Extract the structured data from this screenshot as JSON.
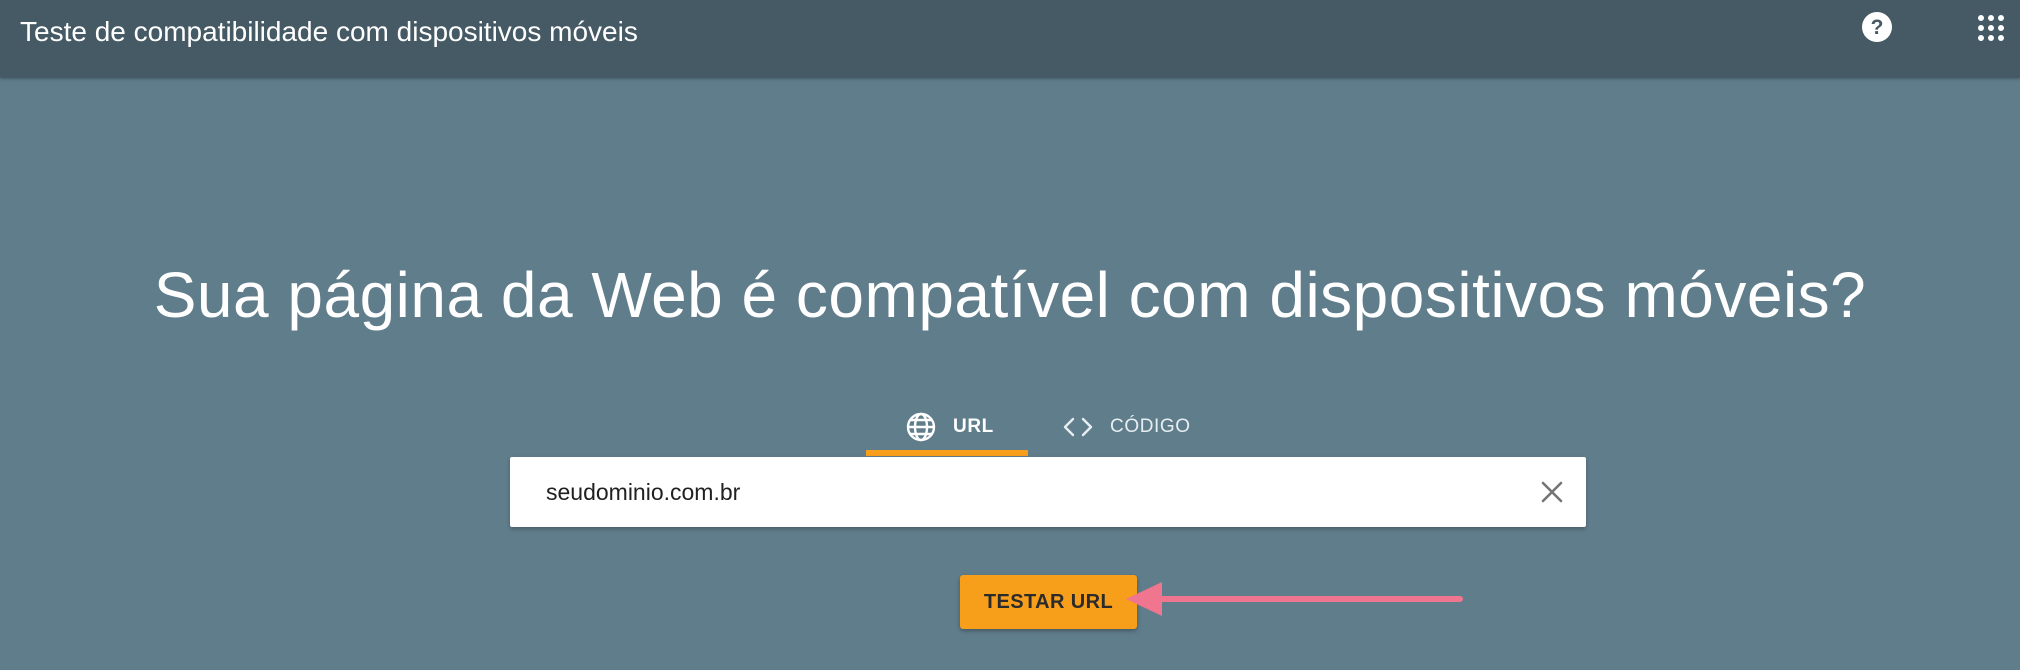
{
  "header": {
    "title": "Teste de compatibilidade com dispositivos móveis",
    "help_icon": "help-circle-icon",
    "apps_icon": "apps-grid-icon"
  },
  "main": {
    "headline": "Sua página da Web é compatível com dispositivos móveis?",
    "tabs": [
      {
        "label": "URL",
        "icon": "globe-icon",
        "selected": true
      },
      {
        "label": "CÓDIGO",
        "icon": "code-brackets-icon",
        "selected": false
      }
    ],
    "url_input": {
      "value": "seudominio.com.br"
    },
    "clear_icon": "close-icon",
    "test_button_label": "TESTAR URL"
  },
  "colors": {
    "page_background": "#607d8b",
    "header_background": "#455a64",
    "accent": "#f79e1b",
    "annotation_arrow": "#f0758f"
  }
}
